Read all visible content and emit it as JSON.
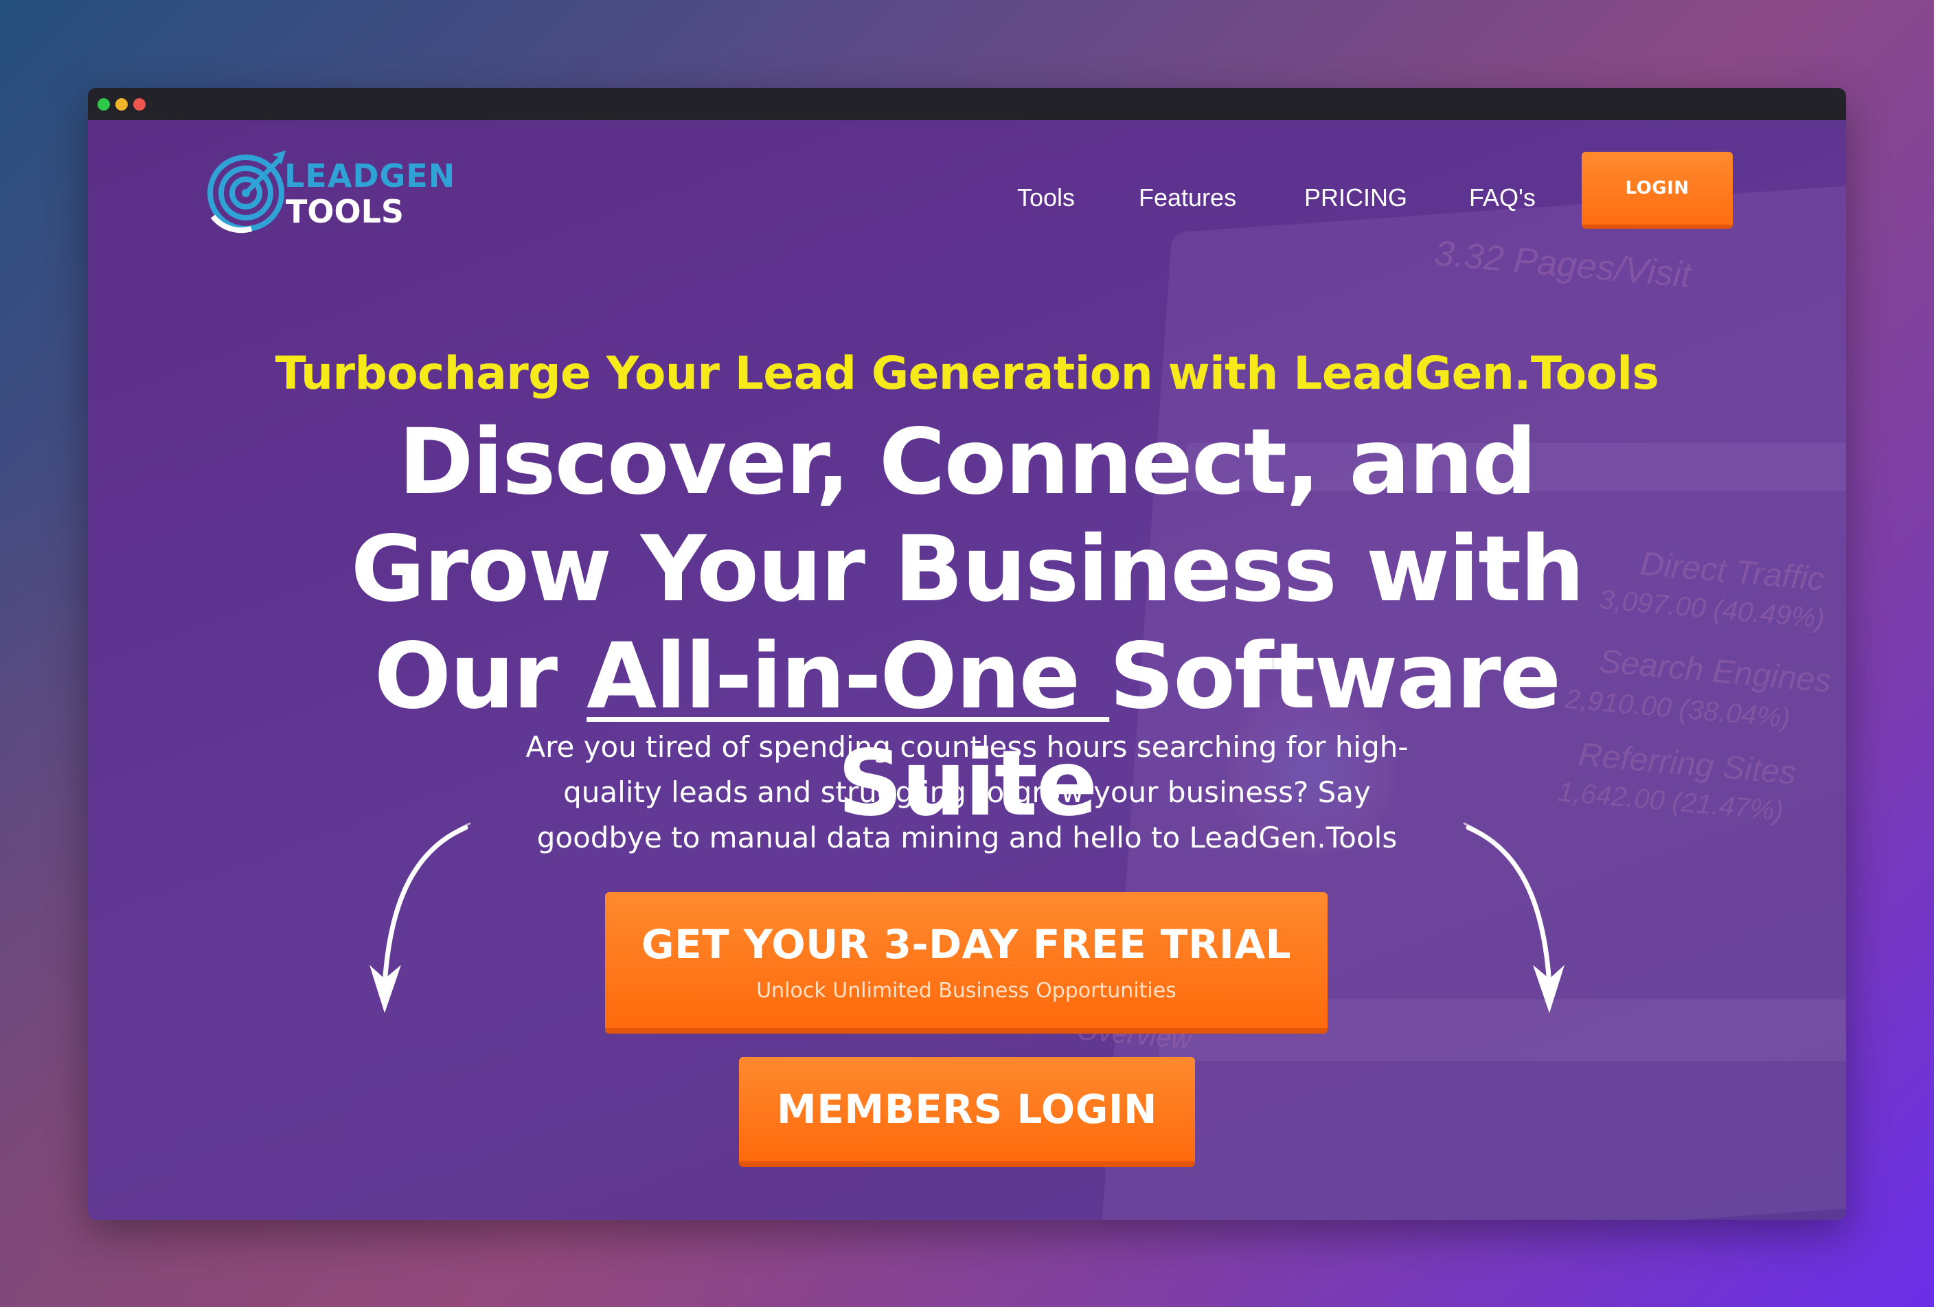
{
  "window": {
    "controls": [
      "close",
      "minimize",
      "maximize"
    ]
  },
  "header": {
    "logo_line1": "LEADGEN",
    "logo_line2": "TOOLS",
    "logo_icon": "target-arrow-icon",
    "nav": [
      {
        "label": "Tools"
      },
      {
        "label": "Features"
      },
      {
        "label": "PRICING"
      },
      {
        "label": "FAQ's"
      }
    ],
    "login_label": "LOGIN"
  },
  "hero": {
    "tagline": "Turbocharge Your Lead Generation with LeadGen.Tools",
    "headline_part1": "Discover, Connect, and Grow Your Business with Our ",
    "headline_underlined": "All-in-One ",
    "headline_part2": "Software Suite",
    "subtext": "Are you tired of spending countless hours searching for high-quality leads and struggling to grow your business? Say goodbye to manual data mining and hello to LeadGen.Tools",
    "trial_button": {
      "label": "GET YOUR 3-DAY FREE TRIAL",
      "sublabel": "Unlock Unlimited Business Opportunities"
    },
    "members_login_label": "MEMBERS LOGIN"
  },
  "background": {
    "texts": [
      "3.32 Pages/Visit",
      "Direct Traffic",
      "3,097.00 (40.49%)",
      "Search Engines",
      "2,910.00 (38.04%)",
      "Referring Sites",
      "1,642.00 (21.47%)",
      "Overview"
    ]
  },
  "colors": {
    "accent_orange": "#ff7a1c",
    "tagline_yellow": "#f7ea1a",
    "logo_blue": "#2fa3d6",
    "hero_purple": "#5e3390"
  }
}
